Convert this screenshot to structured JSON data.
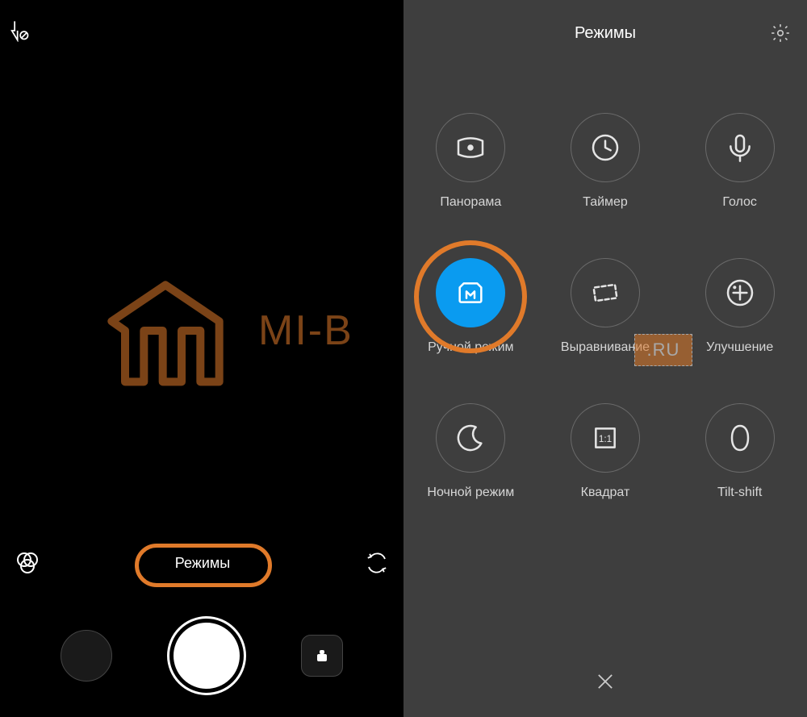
{
  "left": {
    "modes_label": "Режимы",
    "watermark_text": "MI-B"
  },
  "right": {
    "title": "Режимы",
    "modes": [
      {
        "label": "Панорама",
        "icon": "panorama"
      },
      {
        "label": "Таймер",
        "icon": "timer"
      },
      {
        "label": "Голос",
        "icon": "voice"
      },
      {
        "label": "Ручной режим",
        "icon": "manual",
        "active": true,
        "highlight": true
      },
      {
        "label": "Выравнивание",
        "icon": "straighten"
      },
      {
        "label": "Улучшение",
        "icon": "enhance"
      },
      {
        "label": "Ночной режим",
        "icon": "night"
      },
      {
        "label": "Квадрат",
        "icon": "square"
      },
      {
        "label": "Tilt-shift",
        "icon": "tiltshift"
      }
    ],
    "badge": ".RU"
  }
}
